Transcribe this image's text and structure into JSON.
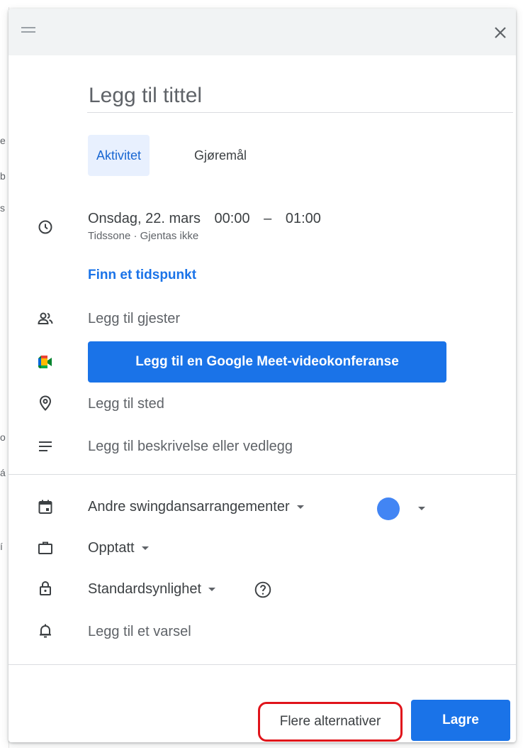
{
  "background": {
    "glyphs": [
      "e",
      "b",
      "s",
      "á",
      "o",
      "í"
    ]
  },
  "dialog": {
    "title_placeholder": "Legg til tittel",
    "tabs": [
      {
        "label": "Aktivitet",
        "active": true
      },
      {
        "label": "Gjøremål",
        "active": false
      }
    ],
    "datetime": {
      "date": "Onsdag, 22. mars",
      "start": "00:00",
      "dash": "–",
      "end": "01:00",
      "sub": "Tidssone · Gjentas ikke"
    },
    "find_time": "Finn et tidspunkt",
    "guests": "Legg til gjester",
    "meet_button": "Legg til en Google Meet-videokonferanse",
    "location": "Legg til sted",
    "description": "Legg til beskrivelse eller vedlegg",
    "calendar": "Andre swingdansarrangementer",
    "calendar_color": "#4285f4",
    "availability": "Opptatt",
    "visibility": "Standardsynlighet",
    "notification": "Legg til et varsel",
    "more_options": "Flere alternativer",
    "save": "Lagre"
  },
  "colors": {
    "accent": "#1a73e8",
    "tab_active_bg": "#e8f0fe",
    "highlight_outline": "#e0141b"
  },
  "icons": [
    "drag-handle-icon",
    "close-icon",
    "clock-icon",
    "people-icon",
    "google-meet-icon",
    "location-pin-icon",
    "description-lines-icon",
    "calendar-icon",
    "briefcase-icon",
    "lock-icon",
    "bell-icon",
    "help-icon",
    "caret-down-icon"
  ]
}
